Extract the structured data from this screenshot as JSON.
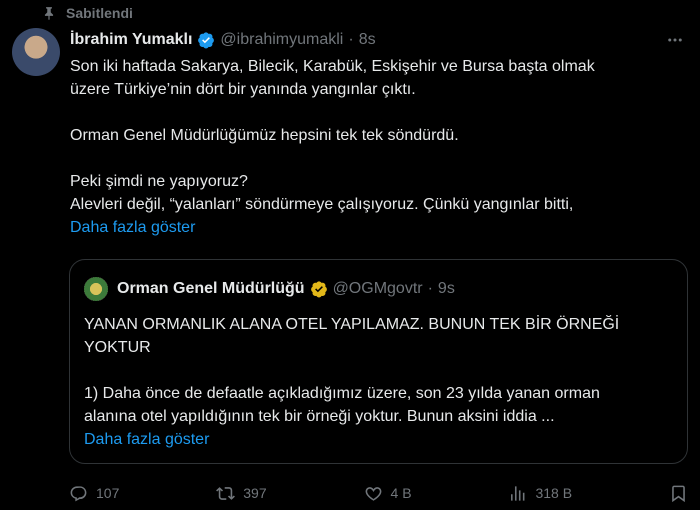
{
  "pinned": {
    "label": "Sabitlendi",
    "icon": "pin-icon"
  },
  "tweet": {
    "author_name": "İbrahim Yumaklı",
    "handle": "@ibrahimyumakli",
    "separator": "·",
    "time": "8s",
    "lines": [
      "Son iki haftada Sakarya, Bilecik, Karabük, Eskişehir ve Bursa başta olmak",
      "üzere Türkiye’nin dört bir yanında yangınlar çıktı.",
      "Orman Genel Müdürlüğümüz hepsini tek tek söndürdü.",
      "Peki şimdi ne yapıyoruz?",
      "Alevleri değil, “yalanları” söndürmeye çalışıyoruz. Çünkü yangınlar bitti,"
    ],
    "show_more": "Daha fazla göster"
  },
  "quote": {
    "author_name": "Orman Genel Müdürlüğü",
    "handle": "@OGMgovtr",
    "separator": "·",
    "time": "9s",
    "lines": [
      "YANAN ORMANLIK ALANA OTEL YAPILAMAZ. BUNUN TEK BİR ÖRNEĞİ",
      "YOKTUR",
      "1) Daha önce de defaatle açıkladığımız üzere, son 23 yılda yanan orman",
      "alanına otel yapıldığının tek bir örneği yoktur. Bunun aksini iddia ..."
    ],
    "show_more": "Daha fazla göster"
  },
  "actions": {
    "replies": "107",
    "reposts": "397",
    "likes": "4 B",
    "views": "318 B"
  },
  "colors": {
    "background": "#000000",
    "text": "#e7e9ea",
    "muted": "#71767b",
    "link": "#1d9bf0",
    "border": "#2f3336",
    "verified_blue": "#1d9bf0",
    "verified_gold": "#e2b719"
  }
}
